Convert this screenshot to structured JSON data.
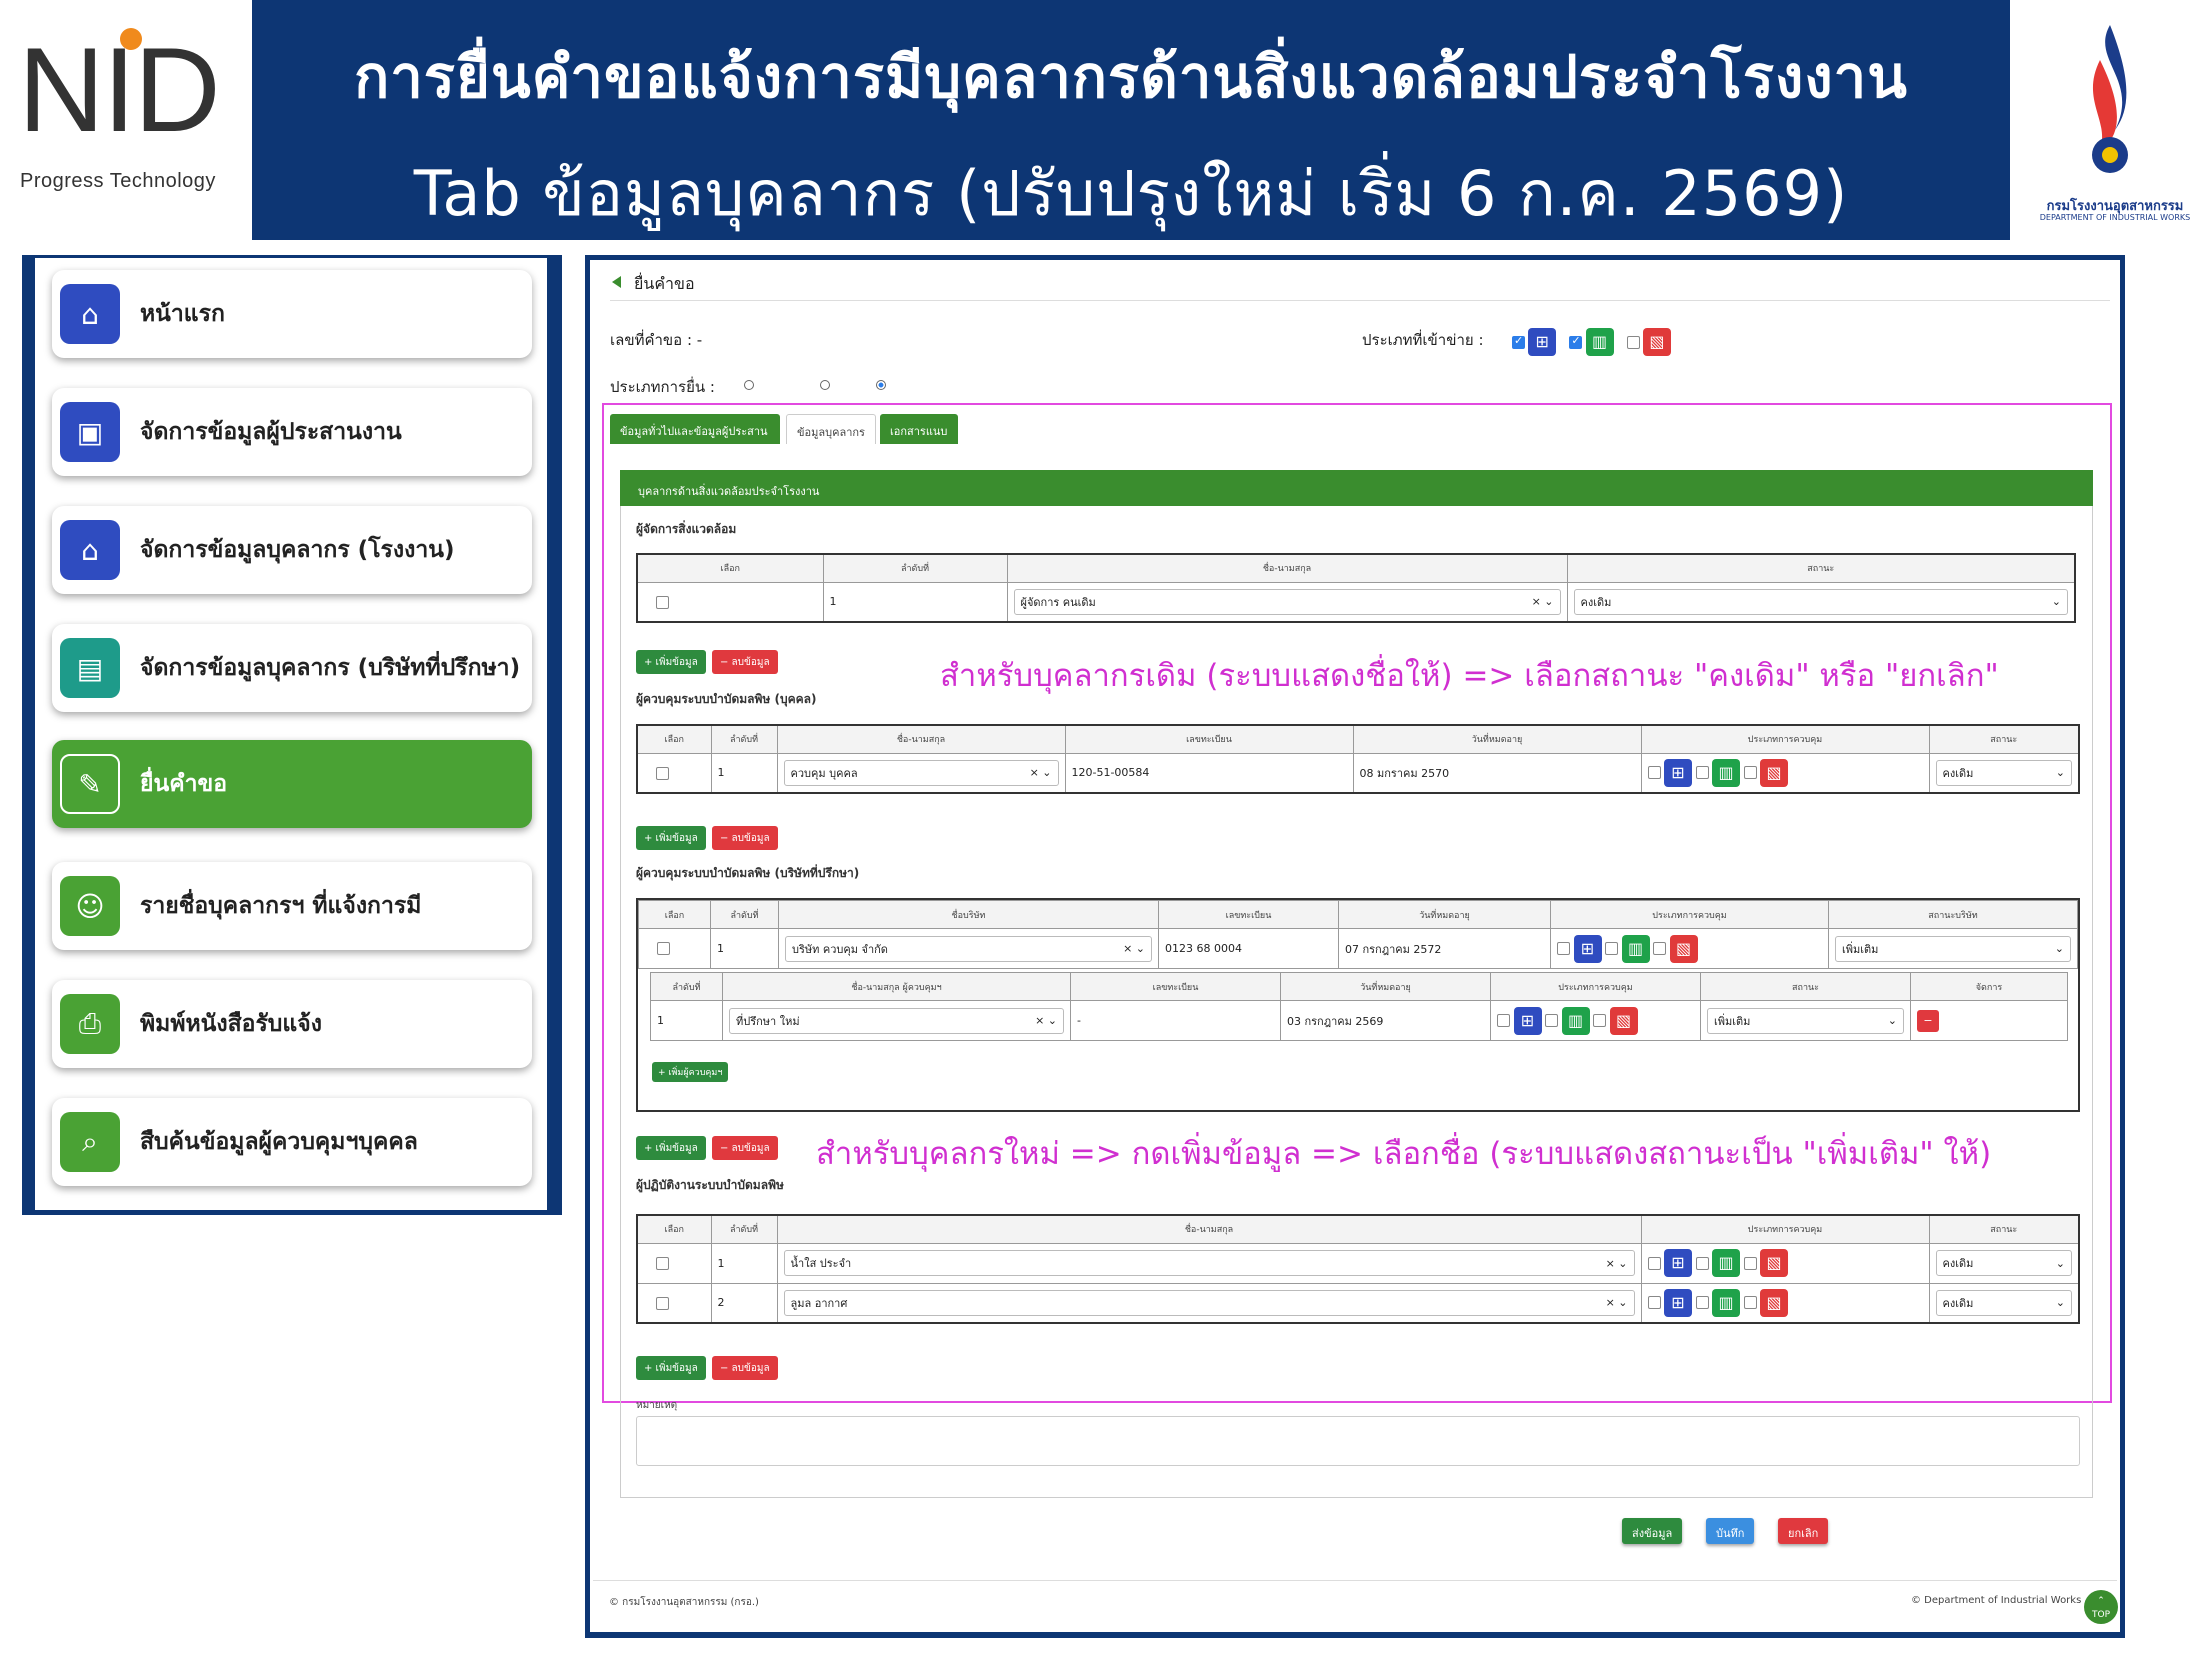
{
  "header": {
    "brand": "NID",
    "brand_sub": "Progress Technology",
    "title_line1": "การยื่นคำขอแจ้งการมีบุคลากรด้านสิ่งแวดล้อมประจำโรงงาน",
    "title_line2": "Tab ข้อมูลบุคลากร (ปรับปรุงใหม่ เริ่ม 6 ก.ค. 2569)",
    "dept_th": "กรมโรงงานอุตสาหกรรม",
    "dept_en": "DEPARTMENT OF INDUSTRIAL WORKS"
  },
  "sidebar": {
    "items": [
      {
        "label": "หน้าแรก",
        "icon": "home-icon",
        "color": "#2f4cc0"
      },
      {
        "label": "จัดการข้อมูลผู้ประสานงาน",
        "icon": "contact-card-icon",
        "color": "#2f4cc0"
      },
      {
        "label": "จัดการข้อมูลบุคลากร (โรงงาน)",
        "icon": "factory-icon",
        "color": "#2f4cc0"
      },
      {
        "label": "จัดการข้อมูลบุคลากร (บริษัทที่ปรึกษา)",
        "icon": "building-icon",
        "color": "#1e9b8a"
      },
      {
        "label": "ยื่นคำขอ",
        "icon": "document-edit-icon",
        "color": "#4aa234",
        "active": true
      },
      {
        "label": "รายชื่อบุคลากรฯ ที่แจ้งการมี",
        "icon": "users-icon",
        "color": "#4aa234"
      },
      {
        "label": "พิมพ์หนังสือรับแจ้ง",
        "icon": "printer-icon",
        "color": "#4aa234"
      },
      {
        "label": "สืบค้นข้อมูลผู้ควบคุมฯบุคคล",
        "icon": "search-icon",
        "color": "#4aa234"
      }
    ]
  },
  "form": {
    "breadcrumb": "ยื่นคำขอ",
    "request_no_label": "เลขที่คำขอ : -",
    "type_label": "ประเภทที่เข้าข่าย :",
    "submit_type_label": "ประเภทการยื่น :",
    "tabs": [
      "ข้อมูลทั่วไปและข้อมูลผู้ประสานงาน",
      "ข้อมูลบุคลากร",
      "เอกสารแนบ"
    ],
    "card_title": "บุคลากรด้านสิ่งแวดล้อมประจำโรงงาน",
    "env_manager": {
      "title": "ผู้จัดการสิ่งแวดล้อม",
      "headers": [
        "เลือก",
        "ลำดับที่",
        "ชื่อ-นามสกุล",
        "สถานะ"
      ],
      "rows": [
        {
          "no": "1",
          "name": "ผู้จัดการ คนเดิม",
          "status": "คงเดิม"
        }
      ]
    },
    "add_label": "+ เพิ่มข้อมูล",
    "del_label": "− ลบข้อมูล",
    "controller_person": {
      "title": "ผู้ควบคุมระบบบำบัดมลพิษ (บุคคล)",
      "headers": [
        "เลือก",
        "ลำดับที่",
        "ชื่อ-นามสกุล",
        "เลขทะเบียน",
        "วันที่หมดอายุ",
        "ประเภทการควบคุม",
        "สถานะ"
      ],
      "rows": [
        {
          "no": "1",
          "name": "ควบคุม บุคคล",
          "reg": "120-51-00584",
          "expire": "08 มกราคม 2570",
          "status": "คงเดิม"
        }
      ]
    },
    "controller_company": {
      "title": "ผู้ควบคุมระบบบำบัดมลพิษ (บริษัทที่ปรึกษา)",
      "headers": [
        "เลือก",
        "ลำดับที่",
        "ชื่อบริษัท",
        "เลขทะเบียน",
        "วันที่หมดอายุ",
        "ประเภทการควบคุม",
        "สถานะบริษัท"
      ],
      "rows": [
        {
          "no": "1",
          "name": "บริษัท ควบคุม จำกัด",
          "reg": "0123 68 0004",
          "expire": "07 กรกฎาคม 2572",
          "status": "เพิ่มเติม"
        }
      ],
      "sub_headers": [
        "ลำดับที่",
        "ชื่อ-นามสกุล ผู้ควบคุมฯ",
        "เลขทะเบียน",
        "วันที่หมดอายุ",
        "ประเภทการควบคุม",
        "สถานะ",
        "จัดการ"
      ],
      "sub_rows": [
        {
          "no": "1",
          "name": "ที่ปรึกษา ใหม่",
          "reg": "-",
          "expire": "03 กรกฎาคม 2569",
          "status": "เพิ่มเติม"
        }
      ],
      "add_person": "+ เพิ่มผู้ควบคุมฯ"
    },
    "operator": {
      "title": "ผู้ปฏิบัติงานระบบบำบัดมลพิษ",
      "headers": [
        "เลือก",
        "ลำดับที่",
        "ชื่อ-นามสกุล",
        "ประเภทการควบคุม",
        "สถานะ"
      ],
      "rows": [
        {
          "no": "1",
          "name": "น้ำใส ประจำ",
          "status": "คงเดิม"
        },
        {
          "no": "2",
          "name": "ลูมล อากาศ",
          "status": "คงเดิม"
        }
      ]
    },
    "remark_label": "หมายเหตุ",
    "note_existing": "สำหรับบุคลากรเดิม (ระบบแสดงชื่อให้) => เลือกสถานะ \"คงเดิม\" หรือ \"ยกเลิก\"",
    "note_new": "สำหรับบุคลกรใหม่ => กดเพิ่มข้อมูล => เลือกชื่อ (ระบบแสดงสถานะเป็น \"เพิ่มเติม\" ให้)",
    "buttons": {
      "send": "ส่งข้อมูล",
      "save": "บันทึก",
      "cancel": "ยกเลิก"
    },
    "footer_left": "© กรมโรงงานอุตสาหกรรม (กรอ.)",
    "footer_right": "© Department of Industrial Works",
    "top": "TOP"
  },
  "colors": {
    "navy": "#0d3674",
    "green": "#3a8d2e",
    "magenta": "#d02fd0",
    "red": "#e0393e",
    "blue": "#2f4cc0"
  }
}
